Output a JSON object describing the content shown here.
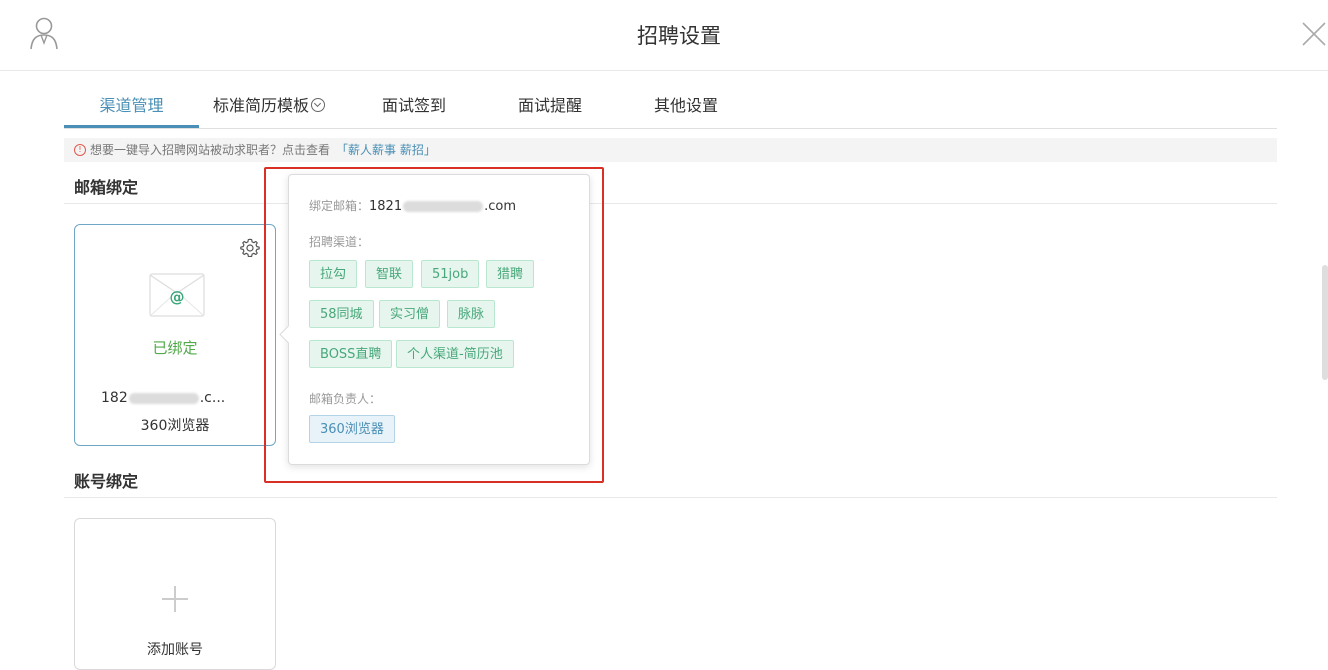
{
  "header": {
    "title": "招聘设置"
  },
  "tabs": [
    {
      "label": "渠道管理",
      "active": true
    },
    {
      "label": "标准简历模板",
      "has_dropdown": true
    },
    {
      "label": "面试签到"
    },
    {
      "label": "面试提醒"
    },
    {
      "label": "其他设置"
    }
  ],
  "notice": {
    "icon": "!",
    "text": "想要一键导入招聘网站被动求职者？点击查看",
    "link": "「薪人薪事 薪招」"
  },
  "sections": {
    "email": "邮箱绑定",
    "account": "账号绑定"
  },
  "email_card": {
    "status": "已绑定",
    "email_prefix": "182",
    "email_suffix": ".c...",
    "owner": "360浏览器",
    "status_color": "#52a94a",
    "border_color": "#6fa7c4"
  },
  "add_card": {
    "label": "添加账号"
  },
  "popover": {
    "email_label": "绑定邮箱：",
    "email_prefix": "1821",
    "email_suffix": ".com",
    "channels_label": "招聘渠道：",
    "channels": [
      "拉勾",
      "智联",
      "51job",
      "猎聘",
      "58同城",
      "实习僧",
      "脉脉",
      "BOSS直聘",
      "个人渠道-简历池"
    ],
    "owner_label": "邮箱负责人：",
    "owners": [
      "360浏览器"
    ]
  },
  "colors": {
    "accent": "#4a8fb5",
    "tag_green": "#48a77a",
    "highlight": "#d93025"
  },
  "icons": {
    "user": "user-icon",
    "close": "close-icon",
    "gear": "gear-icon",
    "envelope": "envelope-icon",
    "plus": "plus-icon",
    "notice": "warning-circle-icon"
  }
}
